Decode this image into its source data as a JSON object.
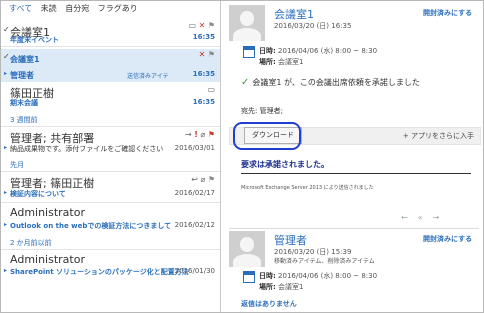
{
  "filters": {
    "all": "すべて",
    "unread": "未読",
    "to_me": "自分宛",
    "flagged": "フラグあり"
  },
  "items": [
    {
      "sender": "会議室1",
      "subject": "年度末イベント",
      "time": "16:35"
    },
    {
      "sender": "会議室1",
      "status": "送信済みアイテ",
      "time": "16:35"
    },
    {
      "sender": "管理者"
    },
    {
      "sender": "篠田正樹",
      "subject": "期末会議",
      "time": "16:35"
    },
    {
      "sender": "管理者; 共有部署",
      "subject": "納品成果物です。添付ファイルをご確認ください",
      "time": "2016/03/01"
    },
    {
      "sender": "管理者; 篠田正樹",
      "subject": "検証内容について",
      "time": "2016/02/17"
    },
    {
      "sender": "Administrator",
      "subject": "Outlook on the webでの検証方法につきまして",
      "time": "2016/02/12"
    },
    {
      "sender": "Administrator",
      "subject": "SharePoint ソリューションのパッケージ化と配置方法",
      "time": "2016/01/30"
    }
  ],
  "groups": {
    "g1": "3 週間前",
    "g2": "先月",
    "g3": "2 か月前以前"
  },
  "reading": {
    "title": "会議室1",
    "date": "2016/03/20 (日) 16:35",
    "mark_unread": "開封済みにする",
    "datetime_label": "日時:",
    "datetime_value": "2016/04/06 (水) 8:00 ~ 8:30",
    "place_label": "場所:",
    "place_value": "会議室1",
    "accept_text": "会議室1 が、この会議出席依頼を承諾しました",
    "to_label": "宛先:",
    "to_value": "管理者;",
    "download": "ダウンロード",
    "get_apps": "アプリをさらに入手",
    "approved": "要求は承諾されました。",
    "footnote": "Microsoft Exchange Server 2013 により送信されました",
    "second_title": "管理者",
    "second_date": "2016/03/20 (日) 15:39",
    "second_sub": "移動済みアイテム、削除済みアイテム",
    "second_mark": "開封済みにする",
    "second_datetime": "2016/04/06 (水) 8:00 ~ 8:30",
    "second_place": "会議室1",
    "load_more": "返信はありません"
  },
  "colors": {
    "accent": "#2a6ebb",
    "selection": "#dce9f7",
    "ring": "#1f3fcf"
  }
}
